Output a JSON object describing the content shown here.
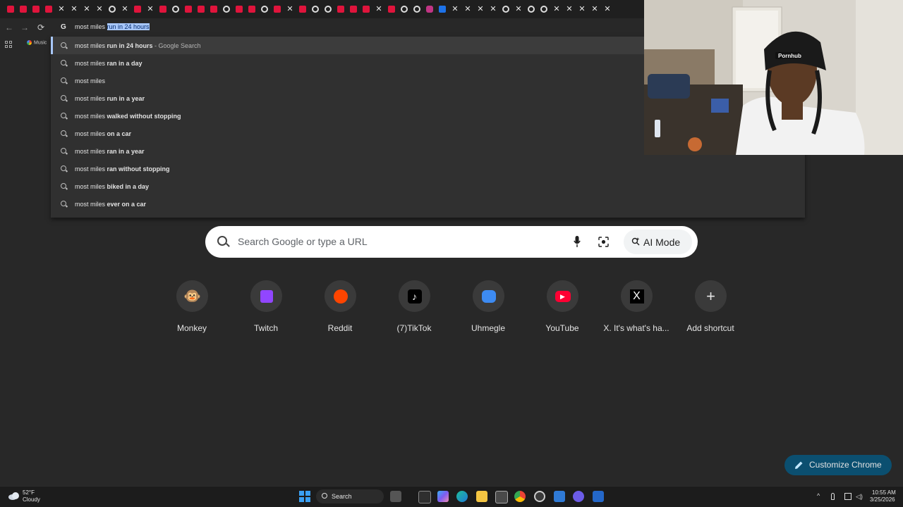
{
  "browser": {
    "tabs": [
      "yt",
      "yt",
      "yt",
      "yt",
      "x",
      "x",
      "x",
      "x",
      "g",
      "x",
      "yt",
      "x",
      "yt",
      "g",
      "yt",
      "yt",
      "yt",
      "g",
      "yt",
      "yt",
      "g",
      "yt",
      "x",
      "yt",
      "g",
      "g",
      "yt",
      "yt",
      "yt",
      "x",
      "yt",
      "g",
      "g",
      "ig",
      "bl",
      "x",
      "x",
      "x",
      "x",
      "g",
      "x",
      "g",
      "g",
      "x",
      "x",
      "x",
      "x",
      "x"
    ],
    "omnibox": {
      "typed": "most miles ",
      "completion": "run in 24 hours"
    },
    "bookmarks": {
      "music": "Music"
    }
  },
  "suggestions": [
    {
      "base": "most miles ",
      "bold": "run in 24 hours",
      "suffix": " - Google Search"
    },
    {
      "base": "most miles ",
      "bold": "ran in a day",
      "suffix": ""
    },
    {
      "base": "most miles",
      "bold": "",
      "suffix": ""
    },
    {
      "base": "most miles ",
      "bold": "run in a year",
      "suffix": ""
    },
    {
      "base": "most miles ",
      "bold": "walked without stopping",
      "suffix": ""
    },
    {
      "base": "most miles ",
      "bold": "on a car",
      "suffix": ""
    },
    {
      "base": "most miles ",
      "bold": "ran in a year",
      "suffix": ""
    },
    {
      "base": "most miles ",
      "bold": "ran without stopping",
      "suffix": ""
    },
    {
      "base": "most miles ",
      "bold": "biked in a day",
      "suffix": ""
    },
    {
      "base": "most miles ",
      "bold": "ever on a car",
      "suffix": ""
    }
  ],
  "newtab": {
    "search_placeholder": "Search Google or type a URL",
    "ai_mode": "AI Mode",
    "customize": "Customize Chrome",
    "shortcuts": [
      {
        "label": "Monkey",
        "icon": "monkey-icon"
      },
      {
        "label": "Twitch",
        "icon": "twitch-icon"
      },
      {
        "label": "Reddit",
        "icon": "reddit-icon"
      },
      {
        "label": "(7)TikTok",
        "icon": "tiktok-icon"
      },
      {
        "label": "Uhmegle",
        "icon": "uhmegle-icon"
      },
      {
        "label": "YouTube",
        "icon": "youtube-icon"
      },
      {
        "label": "X. It's what's ha...",
        "icon": "x-icon"
      },
      {
        "label": "Add shortcut",
        "icon": "plus-icon"
      }
    ]
  },
  "webcam": {
    "cap_text": "Pornhub"
  },
  "taskbar": {
    "weather_temp": "52°F",
    "weather_cond": "Cloudy",
    "search_label": "Search",
    "time": "10:55 AM",
    "date": "3/25/2026"
  },
  "colors": {
    "accent": "#a8c7fa",
    "customize_bg": "#0b4f70",
    "youtube": "#e0143c"
  }
}
